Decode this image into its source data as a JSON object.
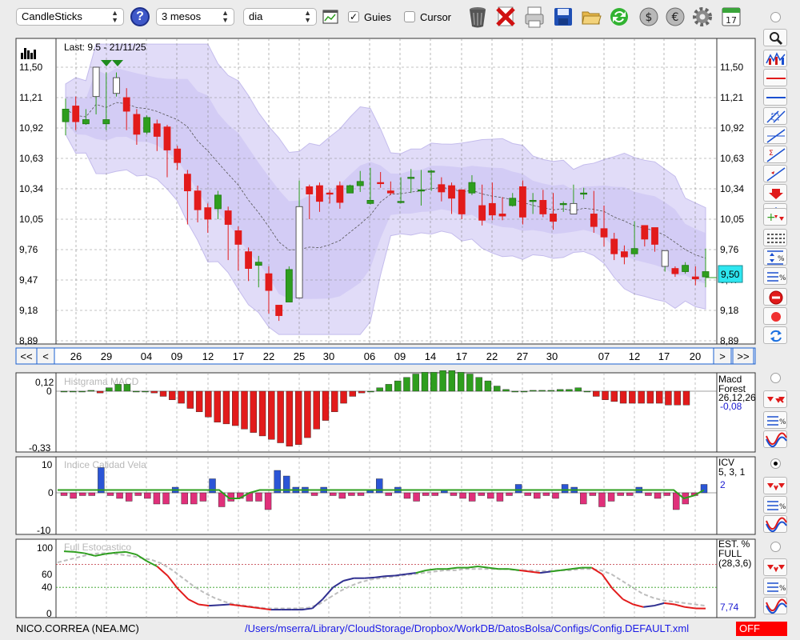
{
  "toolbar": {
    "chart_type": "CandleSticks",
    "period": "3 mesos",
    "interval": "dia",
    "guides_label": "Guies",
    "guides_checked": true,
    "cursor_label": "Cursor",
    "cursor_checked": false,
    "help_label": "?",
    "calendar_day": "17"
  },
  "main_chart": {
    "last_label": "Last: 9.5 - 21/11/25",
    "last_price_tag": "9,50",
    "y_ticks": [
      "11,50",
      "11,21",
      "10,92",
      "10,63",
      "10,34",
      "10,05",
      "9,76",
      "9,47",
      "9,18",
      "8,89"
    ],
    "x_ticks": [
      "26",
      "29",
      "04",
      "09",
      "12",
      "17",
      "22",
      "25",
      "30",
      "06",
      "09",
      "14",
      "17",
      "22",
      "27",
      "30",
      "07",
      "12",
      "17",
      "20"
    ],
    "nav": {
      "first": "<<",
      "prev": "<",
      "next": ">",
      "last": ">>"
    }
  },
  "macd_panel": {
    "title": "Histgrama MACD",
    "name": "Macd",
    "name2": "Forest",
    "params": "26,12,26",
    "value": "-0,08",
    "ticks": [
      "0,12",
      "0",
      "-0,33"
    ]
  },
  "icv_panel": {
    "title": "Indice Calidad Vela",
    "name": "ICV",
    "params": "5, 3, 1",
    "value": "2",
    "ticks": [
      "10",
      "0",
      "-10"
    ]
  },
  "stoch_panel": {
    "title": "Full Estocastico",
    "name": "EST. %",
    "name2": "FULL",
    "params": "(28,3,6)",
    "value": "7,74",
    "ticks": [
      "100",
      "60",
      "40",
      "0"
    ]
  },
  "status": {
    "ticker": "NICO.CORREA (NEA.MC)",
    "config_path": "/Users/mserra/Library/CloudStorage/Dropbox/WorkDB/DatosBolsa/Configs/Config.DEFAULT.xml",
    "mode": "OFF"
  },
  "colors": {
    "up": "#2e9e1e",
    "down": "#e21b1b",
    "band_fill": "#dcd6f7",
    "band_line": "#c4bcec",
    "icv_bar": "#e0307a",
    "icv_up": "#2b55d6",
    "stoch_green": "#2e9e1e",
    "stoch_red": "#e21b1b",
    "stoch_navy": "#303090"
  },
  "chart_data": [
    {
      "type": "candlestick",
      "title": "Last: 9.5 - 21/11/25",
      "ylim": [
        8.89,
        11.5
      ],
      "x": [
        "26",
        "27",
        "28",
        "29",
        "30",
        "01",
        "02",
        "04",
        "05",
        "06",
        "09",
        "10",
        "11",
        "12",
        "13",
        "16",
        "17",
        "18",
        "19",
        "20",
        "22",
        "23",
        "24",
        "25",
        "26",
        "29",
        "30",
        "01",
        "02",
        "03",
        "06",
        "07",
        "08",
        "09",
        "10",
        "13",
        "14",
        "15",
        "16",
        "17",
        "20",
        "21",
        "22",
        "23",
        "24",
        "27",
        "28",
        "29",
        "30",
        "01",
        "04",
        "05",
        "06",
        "07",
        "08",
        "11",
        "12",
        "13",
        "14",
        "17",
        "18",
        "19",
        "20",
        "21"
      ],
      "open": [
        10.98,
        11.13,
        10.96,
        11.22,
        10.96,
        11.25,
        11.21,
        11.05,
        10.88,
        10.96,
        10.93,
        10.72,
        10.48,
        10.32,
        10.16,
        10.15,
        10.13,
        9.94,
        9.74,
        9.61,
        9.53,
        9.23,
        9.26,
        9.3,
        10.36,
        10.37,
        10.3,
        10.37,
        10.3,
        10.37,
        10.2,
        10.4,
        10.32,
        10.22,
        10.45,
        10.33,
        10.5,
        10.38,
        10.37,
        10.33,
        10.3,
        10.18,
        10.2,
        10.1,
        10.18,
        10.36,
        10.23,
        10.23,
        10.1,
        10.2,
        10.1,
        10.3,
        10.1,
        9.96,
        9.86,
        9.74,
        9.72,
        9.99,
        9.97,
        9.6,
        9.58,
        9.55,
        9.5,
        9.5
      ],
      "close": [
        11.1,
        10.98,
        11.0,
        11.5,
        11.0,
        11.4,
        11.08,
        10.86,
        11.02,
        10.84,
        10.71,
        10.59,
        10.32,
        10.14,
        10.05,
        10.28,
        10.0,
        9.81,
        9.58,
        9.64,
        9.37,
        9.13,
        9.57,
        10.17,
        10.29,
        10.22,
        10.29,
        10.21,
        10.37,
        10.41,
        10.23,
        10.39,
        10.3,
        10.22,
        10.45,
        10.33,
        10.51,
        10.31,
        10.25,
        10.1,
        10.4,
        10.04,
        10.09,
        10.08,
        10.25,
        10.07,
        10.23,
        10.1,
        10.03,
        10.2,
        10.2,
        10.3,
        9.98,
        9.88,
        9.72,
        9.69,
        9.77,
        9.86,
        9.81,
        9.75,
        9.53,
        9.61,
        9.48,
        9.55
      ],
      "high": [
        11.2,
        11.22,
        11.1,
        11.5,
        11.45,
        11.45,
        11.3,
        11.1,
        11.04,
        11.0,
        10.95,
        10.75,
        10.52,
        10.37,
        10.2,
        10.32,
        10.17,
        9.98,
        9.78,
        9.7,
        9.6,
        9.2,
        9.6,
        10.42,
        10.38,
        10.4,
        10.33,
        10.41,
        10.38,
        10.51,
        10.54,
        10.5,
        10.41,
        10.45,
        10.53,
        10.52,
        10.52,
        10.45,
        10.4,
        10.33,
        10.47,
        10.38,
        10.4,
        10.26,
        10.3,
        10.42,
        10.3,
        10.33,
        10.3,
        10.22,
        10.38,
        10.35,
        10.32,
        10.18,
        9.92,
        9.8,
        10.03,
        9.93,
        9.97,
        9.7,
        9.6,
        9.64,
        9.6,
        9.77
      ],
      "low": [
        10.85,
        10.9,
        10.95,
        11.05,
        10.9,
        11.22,
        10.9,
        10.76,
        10.86,
        10.7,
        10.45,
        10.52,
        10.0,
        10.02,
        9.92,
        10.05,
        9.66,
        9.56,
        9.46,
        9.4,
        9.15,
        9.08,
        9.26,
        10.05,
        10.05,
        10.12,
        10.2,
        10.15,
        10.3,
        10.31,
        10.19,
        10.35,
        10.28,
        10.2,
        10.3,
        10.18,
        10.32,
        10.22,
        10.1,
        10.05,
        10.28,
        9.99,
        10.04,
        10.04,
        10.17,
        10.0,
        10.1,
        10.07,
        9.95,
        10.12,
        10.11,
        10.24,
        9.92,
        9.79,
        9.66,
        9.62,
        9.69,
        9.79,
        9.74,
        9.55,
        9.5,
        9.53,
        9.42,
        9.4
      ]
    },
    {
      "type": "bar",
      "title": "Histgrama MACD",
      "ylim": [
        -0.33,
        0.12
      ],
      "values": [
        0,
        0,
        0,
        0.005,
        -0.01,
        0.02,
        0.04,
        0.04,
        0,
        0,
        -0.01,
        -0.03,
        -0.05,
        -0.07,
        -0.1,
        -0.12,
        -0.15,
        -0.18,
        -0.19,
        -0.2,
        -0.22,
        -0.24,
        -0.26,
        -0.28,
        -0.3,
        -0.32,
        -0.31,
        -0.27,
        -0.22,
        -0.17,
        -0.12,
        -0.07,
        -0.03,
        -0.01,
        0,
        0.02,
        0.04,
        0.06,
        0.08,
        0.1,
        0.11,
        0.11,
        0.12,
        0.12,
        0.11,
        0.1,
        0.08,
        0.06,
        0.03,
        0.01,
        0,
        0,
        0.005,
        0.005,
        0.005,
        0.01,
        0.01,
        0.02,
        0,
        -0.03,
        -0.05,
        -0.06,
        -0.07,
        -0.07,
        -0.07,
        -0.07,
        -0.07,
        -0.08,
        -0.08,
        -0.08
      ]
    },
    {
      "type": "bar",
      "title": "Indice Calidad Vela",
      "ylim": [
        -10,
        10
      ],
      "values": [
        -1,
        -2,
        -1,
        -1,
        9,
        -1,
        -2,
        -3,
        -1,
        -2,
        -4,
        -4,
        2,
        -4,
        -4,
        -3,
        5,
        -5,
        -3,
        -2,
        -3,
        -3,
        -6,
        8,
        6,
        2,
        2,
        -1,
        2,
        -1,
        -2,
        -1,
        -1,
        1,
        5,
        -1,
        2,
        -2,
        -3,
        -1,
        -1,
        1,
        -1,
        -2,
        -3,
        -1,
        -2,
        -3,
        -1,
        3,
        -1,
        -2,
        -1,
        -2,
        3,
        2,
        -4,
        -1,
        -5,
        -3,
        -1,
        -1,
        2,
        -1,
        -2,
        -1,
        -6,
        -4,
        -1,
        3
      ],
      "series": [
        {
          "name": "ICV",
          "values": [
            1,
            1,
            1,
            1,
            1,
            1,
            1,
            1,
            1,
            1,
            1,
            1,
            1,
            1,
            1,
            1,
            1,
            -2,
            -2,
            0,
            1,
            1,
            1,
            1,
            1,
            1,
            1,
            1,
            1,
            1,
            1,
            1,
            1,
            1,
            1,
            1,
            1,
            1,
            1,
            1,
            1,
            1,
            1,
            1,
            1,
            1,
            1,
            1,
            1,
            1,
            1,
            1,
            1,
            1,
            1,
            1,
            1,
            1,
            1,
            1,
            1,
            1,
            -2,
            -1,
            1
          ]
        }
      ]
    },
    {
      "type": "line",
      "title": "Full Estocastico",
      "ylim": [
        0,
        100
      ],
      "series": [
        {
          "name": "EST. % FULL",
          "values": [
            95,
            94,
            92,
            88,
            91,
            93,
            94,
            90,
            80,
            72,
            58,
            38,
            22,
            14,
            12,
            13,
            14,
            12,
            10,
            8,
            6,
            6,
            6,
            6,
            8,
            22,
            40,
            50,
            54,
            54,
            55,
            57,
            58,
            60,
            62,
            66,
            68,
            68,
            70,
            70,
            72,
            70,
            68,
            68,
            66,
            64,
            62,
            64,
            66,
            68,
            70,
            70,
            60,
            38,
            22,
            14,
            10,
            12,
            16,
            14,
            10,
            8,
            7.74
          ]
        },
        {
          "name": "signal",
          "values": [
            78,
            82,
            86,
            90,
            92,
            92,
            90,
            88,
            85,
            82,
            76,
            66,
            54,
            42,
            32,
            24,
            18,
            14,
            12,
            10,
            8,
            8,
            8,
            8,
            9,
            14,
            24,
            34,
            42,
            48,
            52,
            54,
            56,
            58,
            60,
            62,
            64,
            66,
            66,
            68,
            68,
            68,
            68,
            68,
            66,
            66,
            65,
            65,
            66,
            66,
            68,
            68,
            66,
            60,
            50,
            40,
            30,
            24,
            20,
            18,
            16,
            14,
            12
          ]
        }
      ]
    }
  ]
}
